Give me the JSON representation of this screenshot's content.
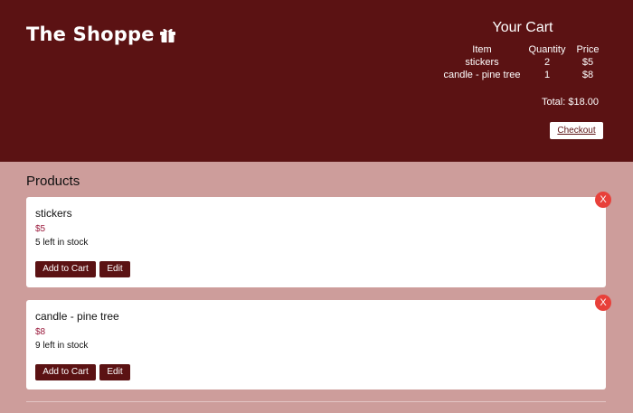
{
  "brand": {
    "name": "The Shoppe",
    "icon": "gift-icon"
  },
  "cart": {
    "title": "Your Cart",
    "headers": {
      "item": "Item",
      "quantity": "Quantity",
      "price": "Price"
    },
    "rows": [
      {
        "item": "stickers",
        "quantity": "2",
        "price": "$5"
      },
      {
        "item": "candle - pine tree",
        "quantity": "1",
        "price": "$8"
      }
    ],
    "total": "Total: $18.00",
    "checkout_label": "Checkout"
  },
  "products": {
    "title": "Products",
    "items": [
      {
        "name": "stickers",
        "price": "$5",
        "stock": "5 left in stock",
        "add_label": "Add to Cart",
        "edit_label": "Edit",
        "delete_label": "X"
      },
      {
        "name": "candle - pine tree",
        "price": "$8",
        "stock": "9 left in stock",
        "add_label": "Add to Cart",
        "edit_label": "Edit",
        "delete_label": "X"
      }
    ]
  },
  "colors": {
    "header_bg": "#5b1213",
    "page_bg": "#cd9d9b",
    "button_bg": "#5b1213",
    "price_text": "#9a1a3c",
    "delete_bg": "#e8403a"
  }
}
